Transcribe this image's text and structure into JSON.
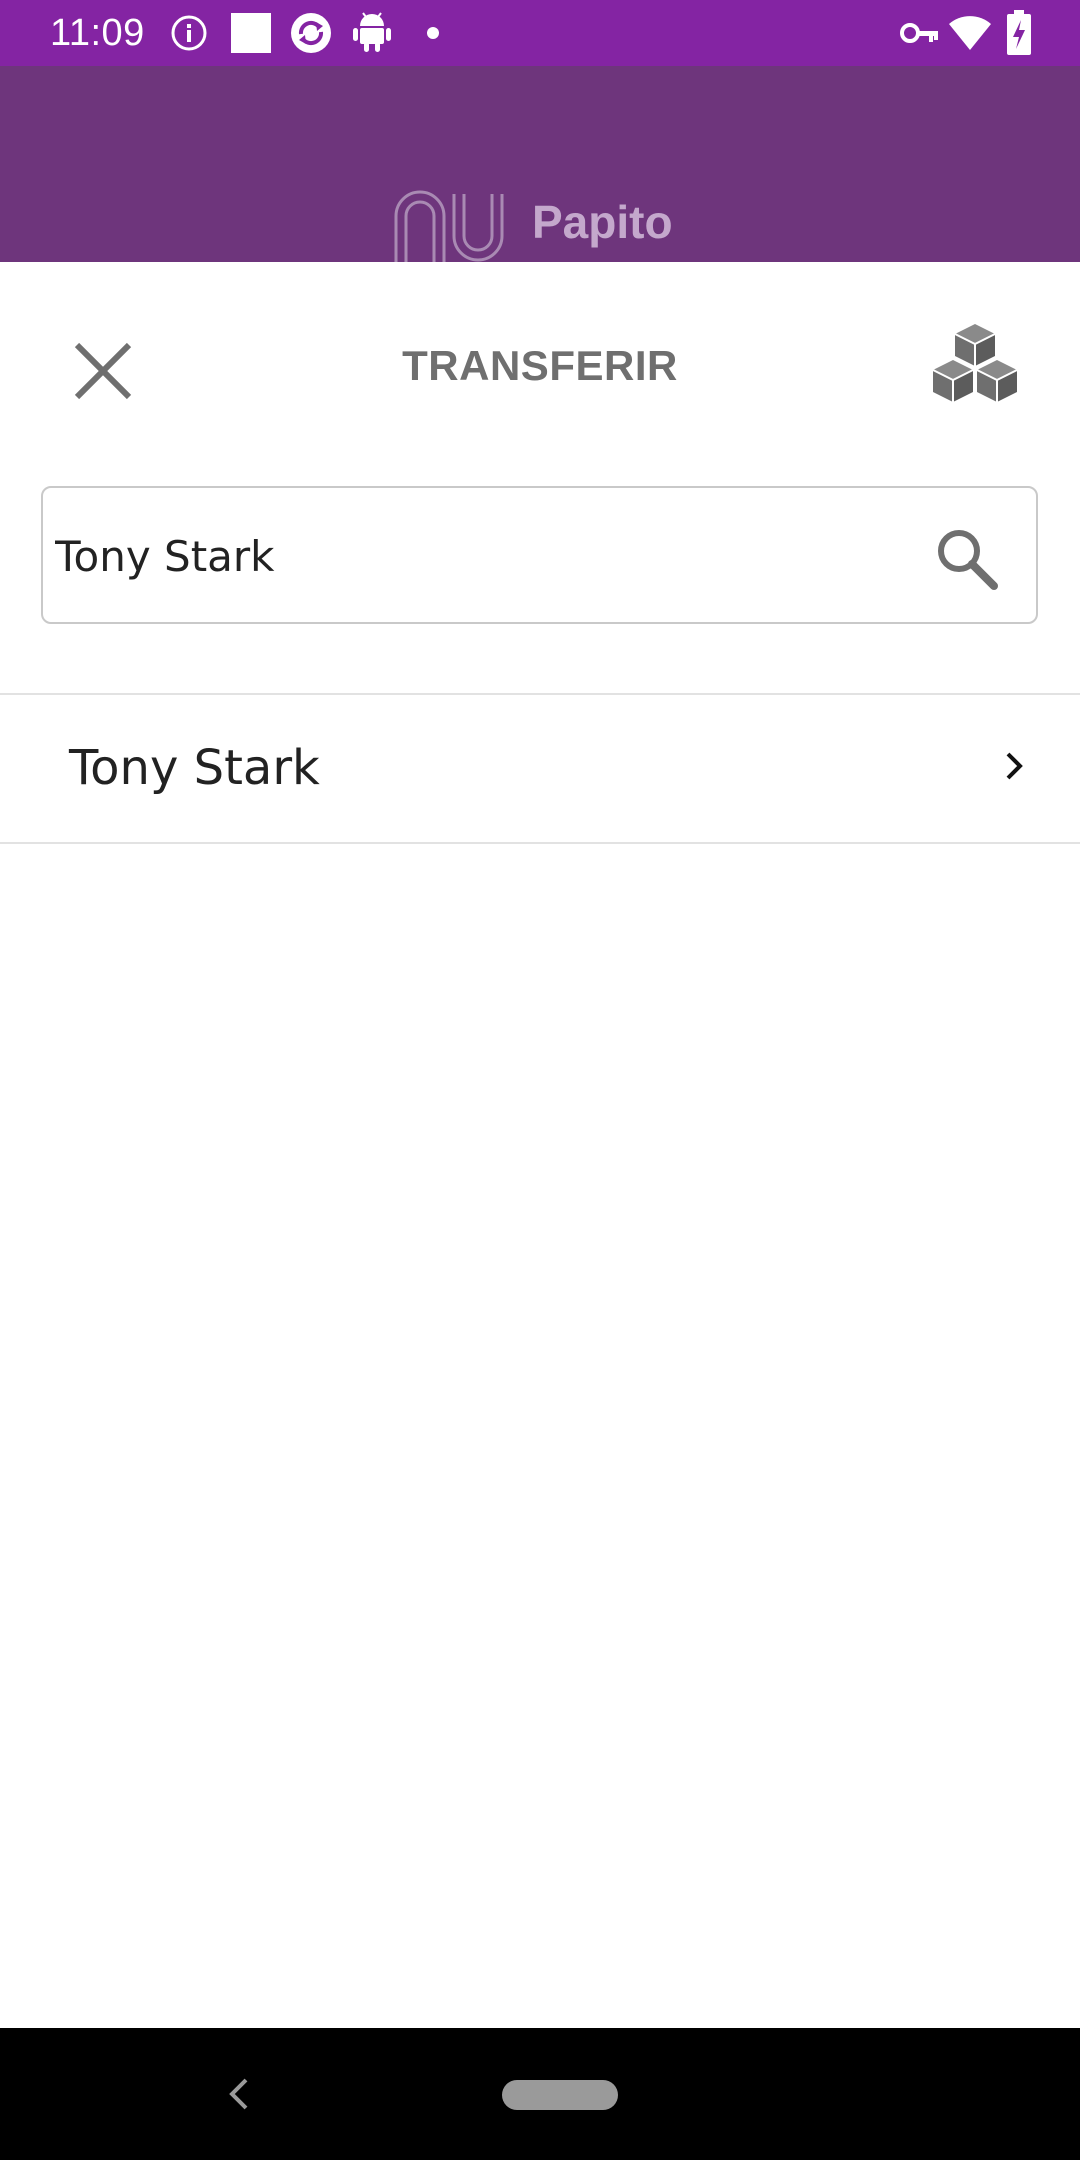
{
  "status_bar": {
    "time": "11:09",
    "background": "#8424a3",
    "left_icons": [
      "info-icon",
      "square-icon",
      "sync-icon",
      "android-icon",
      "dot-icon"
    ],
    "right_icons": [
      "vpn-key-icon",
      "wifi-icon",
      "battery-charging-icon"
    ]
  },
  "app_header": {
    "brand_name": "Papito",
    "logo": "nu-logo"
  },
  "sheet": {
    "title": "TRANSFERIR",
    "close_icon": "close-icon",
    "action_icon": "blocks-icon",
    "search": {
      "value": "Tony Stark",
      "placeholder": ""
    },
    "results": [
      {
        "name": "Tony Stark"
      }
    ]
  },
  "nav_bar": {
    "back_icon": "back-icon",
    "home_icon": "home-pill"
  }
}
